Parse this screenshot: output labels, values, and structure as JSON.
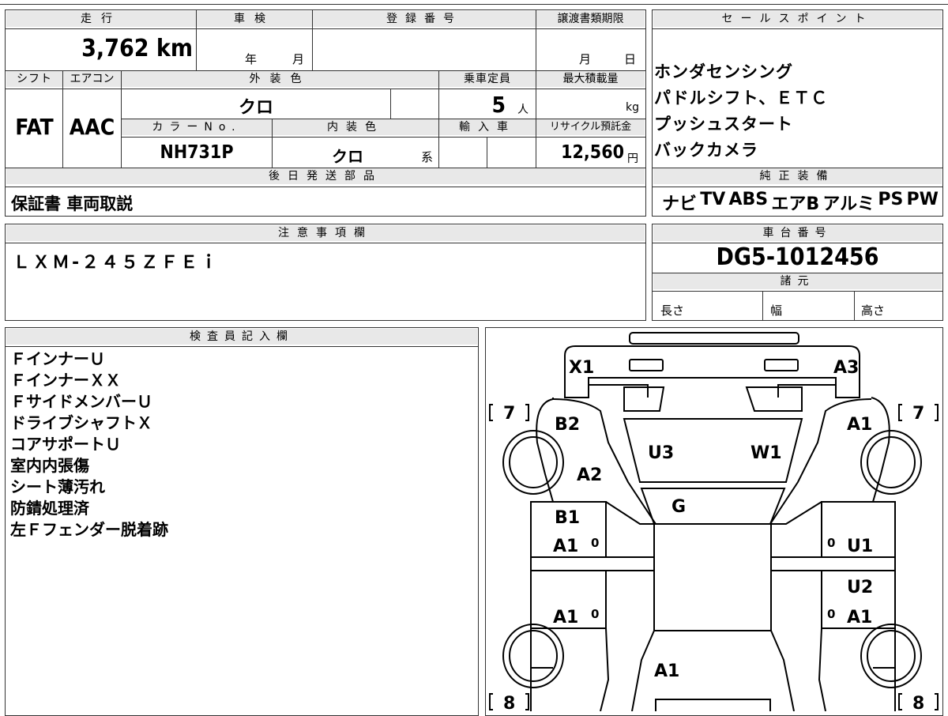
{
  "mileage": {
    "label": "走行",
    "value": "3,762",
    "unit": "km"
  },
  "inspection": {
    "label": "車検",
    "year_unit": "年",
    "month_unit": "月"
  },
  "registration": {
    "label": "登録番号"
  },
  "transfer_deadline": {
    "label": "譲渡書類期限",
    "month_unit": "月",
    "day_unit": "日"
  },
  "shift": {
    "label": "シフト",
    "value": "FAT"
  },
  "aircon": {
    "label": "エアコン",
    "value": "AAC"
  },
  "exterior_color": {
    "label": "外装色",
    "value": "クロ"
  },
  "capacity": {
    "label": "乗車定員",
    "value": "5",
    "unit": "人"
  },
  "max_load": {
    "label": "最大積載量",
    "unit": "kg"
  },
  "color_no": {
    "label": "カラーNo.",
    "value": "NH731P"
  },
  "interior_color": {
    "label": "内装色",
    "value": "クロ",
    "suffix": "系"
  },
  "import": {
    "label": "輸入車"
  },
  "recycle": {
    "label": "リサイクル預託金",
    "value": "12,560",
    "unit": "円"
  },
  "later_parts": {
    "label": "後日発送部品",
    "value": "保証書 車両取説"
  },
  "sales_points": {
    "label": "セールスポイント",
    "items": [
      "ホンダセンシング",
      "パドルシフト、ＥＴＣ",
      "プッシュスタート",
      "バックカメラ"
    ]
  },
  "equipment": {
    "label": "純正装備",
    "items": [
      "ナビ",
      "TV",
      "ABS",
      "エアB",
      "アルミ",
      "PS",
      "PW"
    ]
  },
  "caution": {
    "label": "注意事項欄",
    "value": "ＬＸＭ-２４５ＺＦＥｉ"
  },
  "chassis": {
    "label": "車台番号",
    "value": "DG5-1012456"
  },
  "specs": {
    "label": "諸元",
    "length": "長さ",
    "width": "幅",
    "height": "高さ"
  },
  "inspector": {
    "label": "検査員記入欄",
    "lines": [
      "ＦインナーＵ",
      "ＦインナーＸＸ",
      "ＦサイドメンバーＵ",
      "ドライブシャフトＸ",
      "コアサポートＵ",
      "室内内張傷",
      "シート薄汚れ",
      "防錆処理済",
      "左Ｆフェンダー脱着跡"
    ]
  },
  "diagram": {
    "codes": {
      "x1": "X1",
      "a3": "A3",
      "b2": "B2",
      "a1_fr": "A1",
      "u3": "U3",
      "w1": "W1",
      "a2": "A2",
      "g": "G",
      "b1": "B1",
      "a1_l1": "A1",
      "u1": "U1",
      "u2": "U2",
      "a1_l2": "A1",
      "a1_r2": "A1",
      "a1_rear": "A1"
    },
    "zeros": [
      "0",
      "0",
      "0",
      "0"
    ],
    "tires": {
      "fl": "7",
      "fr": "7",
      "rl": "8",
      "rr": "8"
    }
  }
}
